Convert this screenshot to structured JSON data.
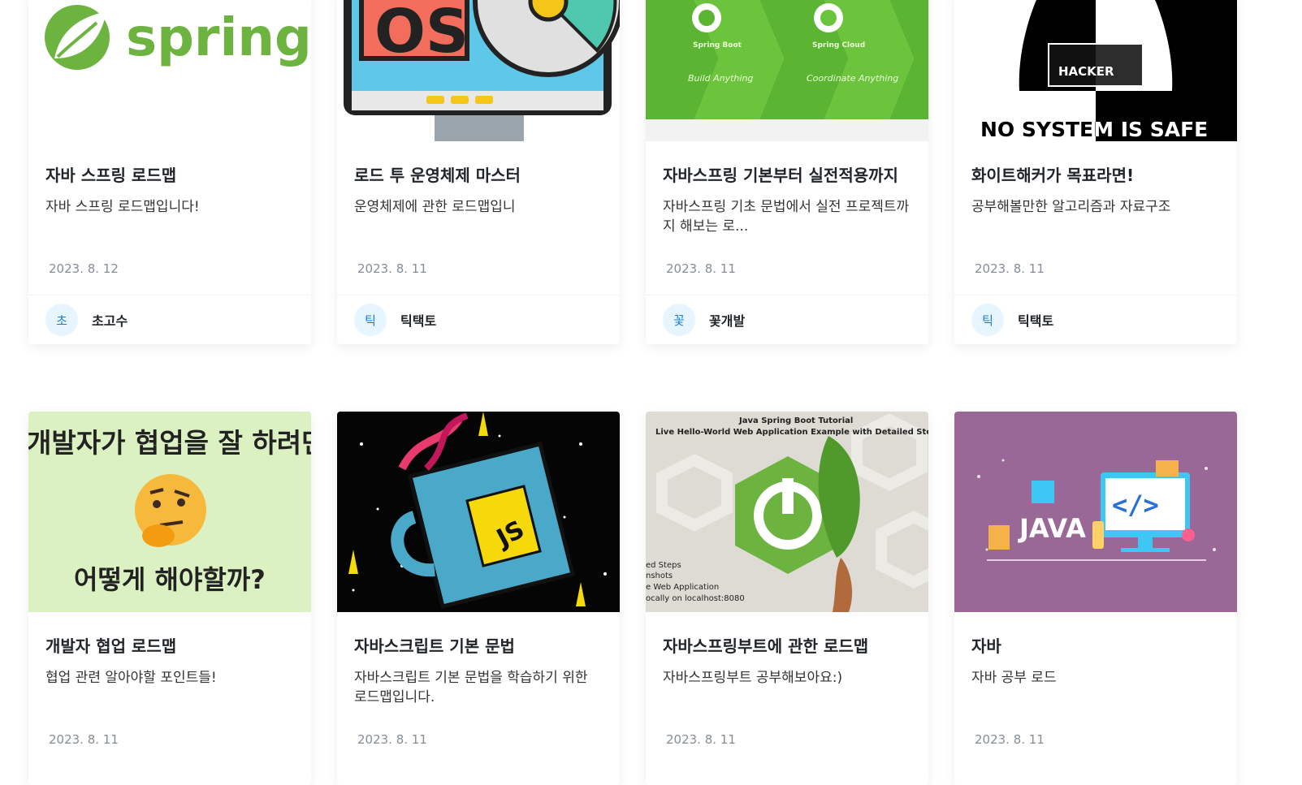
{
  "cards": [
    {
      "thumb": {
        "logo_text": "spring"
      },
      "title": "자바 스프링 로드맵",
      "description": "자바 스프링 로드맵입니다!",
      "date": "2023. 8. 12",
      "author": {
        "initial": "초",
        "name": "초고수"
      }
    },
    {
      "thumb": {
        "text": "OS"
      },
      "title": "로드 투 운영체제 마스터",
      "description": "운영체제에 관한 로드맵입니",
      "date": "2023. 8. 11",
      "author": {
        "initial": "틱",
        "name": "틱택토"
      }
    },
    {
      "thumb": {
        "label_boot": "Spring Boot",
        "label_cloud": "Spring Cloud",
        "tag_boot": "Build Anything",
        "tag_cloud": "Coordinate Anything"
      },
      "title": "자바스프링 기본부터 실전적용까지",
      "description": "자바스프링 기초 문법에서 실전 프로젝트까지 해보는 로...",
      "date": "2023. 8. 11",
      "author": {
        "initial": "꽃",
        "name": "꽃개발"
      }
    },
    {
      "thumb": {
        "badge": "HACKER",
        "caption": "NO SYSTEM IS SAFE"
      },
      "title": "화이트해커가 목표라면!",
      "description": "공부해볼만한 알고리즘과 자료구조",
      "date": "2023. 8. 11",
      "author": {
        "initial": "틱",
        "name": "틱택토"
      }
    },
    {
      "thumb": {
        "line1": "개발자가 협업을 잘 하려면",
        "line2": "어떻게 해야할까?"
      },
      "title": "개발자 협업 로드맵",
      "description": "협업 관련 알아야할 포인트들!",
      "date": "2023. 8. 11"
    },
    {
      "thumb": {
        "mug_text": "JS"
      },
      "title": "자바스크립트 기본 문법",
      "description": "자바스크립트 기본 문법을 학습하기 위한 로드맵입니다.",
      "date": "2023. 8. 11"
    },
    {
      "thumb": {
        "line1": "Java Spring Boot Tutorial",
        "line2": "Live Hello-World Web Application Example with Detailed Steps",
        "side1": "ed Steps",
        "side2": "nshots",
        "side3": "e Web Application",
        "side4": "ocally on localhost:8080"
      },
      "title": "자바스프링부트에 관한 로드맵",
      "description": "자바스프링부트 공부해보아요:)",
      "date": "2023. 8. 11"
    },
    {
      "thumb": {
        "text": "JAVA"
      },
      "title": "자바",
      "description": "자바 공부 로드",
      "date": "2023. 8. 11"
    }
  ],
  "colors": {
    "spring_green": "#6db33f",
    "avatar_bg": "#e7f5ff",
    "avatar_fg": "#1c7ed6",
    "date": "#868e96"
  }
}
